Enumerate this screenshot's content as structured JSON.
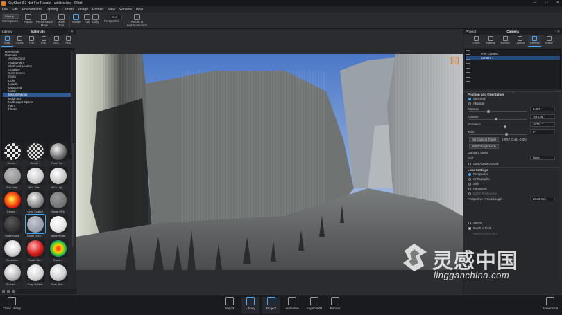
{
  "window": {
    "title": "KeyShot 8.2 Not For Resale - untitled.bip - 64 bit",
    "controls": [
      "—",
      "☐",
      "✕"
    ]
  },
  "menu": [
    "File",
    "Edit",
    "Environment",
    "Lighting",
    "Camera",
    "Image",
    "Render",
    "View",
    "Window",
    "Help"
  ],
  "toolbar": {
    "startup": "Startup",
    "buttons": [
      {
        "label": "Workspaces"
      },
      {
        "label": "Pause"
      },
      {
        "label": "Performance\nMode"
      },
      {
        "label": "Move\nTool"
      },
      {
        "label": "Tumble"
      },
      {
        "label": "Pan"
      },
      {
        "label": "Dolly"
      },
      {
        "label": "Perspective"
      },
      {
        "label": "Return to\nLink Application"
      }
    ],
    "fps": "25.3"
  },
  "library": {
    "panel_title": "Library",
    "section_title": "Materials",
    "tabs": [
      "Mats",
      "Colors",
      "Text.",
      "Envi.",
      "Back.",
      "Favo."
    ],
    "tree_root": "Downloads",
    "tree_parent": "Materials",
    "tree": [
      "Architectural",
      "Axalta Paint",
      "Cloth and Leather",
      "Cutaway",
      "Gem Stones",
      "Glass",
      "Light",
      "Liquids",
      "Measured",
      "Metal",
      "Miscellaneous",
      "Mold-Tech",
      "Multi-Layer Optics",
      "Paint",
      "Plastic"
    ],
    "selected_tree_item": "Miscellaneous",
    "thumbs": [
      {
        "label": "Check..."
      },
      {
        "label": "Check..."
      },
      {
        "label": "Flash Re..."
      },
      {
        "label": "Flat Grey"
      },
      {
        "label": "HDA Diffu..."
      },
      {
        "label": "HDA Liqu..."
      },
      {
        "label": "Infrare..."
      },
      {
        "label": "Lens Coated"
      },
      {
        "label": "Matte 50%"
      },
      {
        "label": "Matte Black"
      },
      {
        "label": "Matte Grey..."
      },
      {
        "label": "Matte White"
      },
      {
        "label": "Occlusion"
      },
      {
        "label": "Plastic Clo..."
      },
      {
        "label": "Rainb..."
      },
      {
        "label": "Shaded ..."
      },
      {
        "label": "Soap Bubble"
      },
      {
        "label": "Soap Bub..."
      }
    ]
  },
  "project": {
    "panel_title": "Project",
    "section_title": "Camera",
    "tabs": [
      "Scene",
      "Material",
      "Environ.",
      "Lighting",
      "Camera",
      "Image"
    ],
    "cameras": [
      "Free Camera",
      "Camera 1"
    ],
    "position_section": "Position and Orientation",
    "mode_options": [
      "Spherical",
      "Absolute"
    ],
    "fields": [
      {
        "label": "Distance",
        "value": "0.487"
      },
      {
        "label": "Azimuth",
        "value": "-49.726 °"
      },
      {
        "label": "Inclination",
        "value": "-3.751 °"
      },
      {
        "label": "Twist",
        "value": "0 °"
      }
    ],
    "set_target_button": "Set Camera Target",
    "target_value": "(-0.57, 0.46, -0.39)",
    "walkthrough_button": "Walkthrough Mode",
    "standard_views_label": "Standard Views",
    "grid_label": "Grid",
    "grid_value": "None",
    "stay_above_ground": "Stay Above Ground",
    "lens_section": "Lens Settings",
    "lens_options": [
      "Perspective",
      "Orthographic",
      "Shift",
      "Panoramic",
      "Match Perspective"
    ],
    "focal_label": "Perspective / Focal Length",
    "focal_value": "23.33 mm",
    "stereo_label": "Stereo",
    "dof_label": "Depth of Field",
    "select_focus_point": "Select Focus Point"
  },
  "bottombar": {
    "cloud_library": "Cloud Library",
    "items": [
      "Import",
      "Library",
      "Project",
      "Animation",
      "KeyShotXR",
      "Render"
    ],
    "screenshot": "Screenshot"
  },
  "watermark": {
    "cn": "灵感中国",
    "url": "lingganchina.com"
  },
  "colors": {
    "accent": "#3fa9ff",
    "selection": "#2f5a94",
    "logo_orange": "#e07b20"
  }
}
